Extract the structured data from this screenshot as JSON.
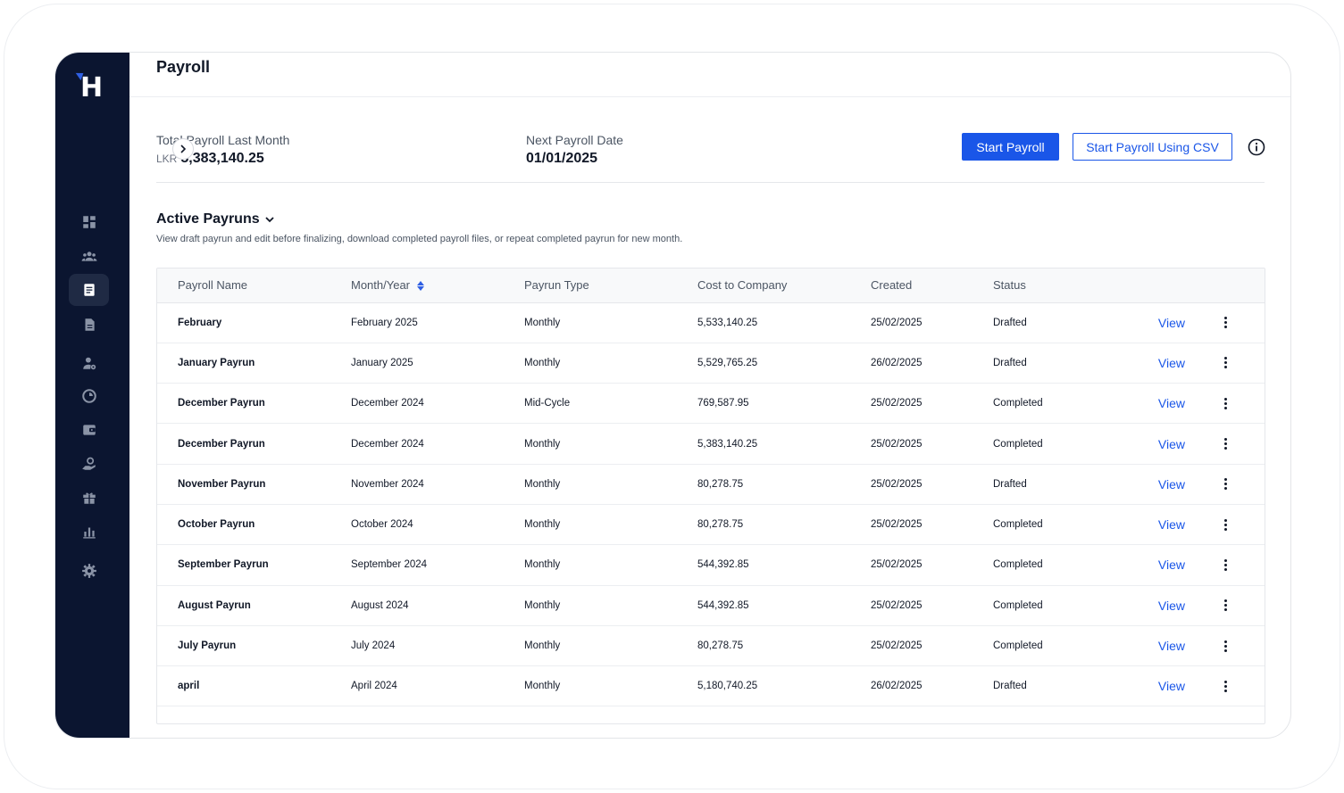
{
  "header": {
    "title": "Payroll"
  },
  "summary": {
    "total_label": "Total Payroll Last Month",
    "total_currency": "LKR",
    "total_value": "5,383,140.25",
    "next_label": "Next Payroll Date",
    "next_value": "01/01/2025"
  },
  "actions": {
    "start_payroll": "Start Payroll",
    "start_payroll_csv": "Start Payroll Using CSV"
  },
  "section": {
    "title": "Active Payruns",
    "description": "View draft payrun and edit before finalizing, download completed payroll files, or repeat completed payrun for new month."
  },
  "sidebar": {
    "logo": "H",
    "items": [
      {
        "icon": "dashboard-icon"
      },
      {
        "icon": "people-icon"
      },
      {
        "icon": "payroll-icon",
        "active": true
      },
      {
        "icon": "document-icon"
      },
      {
        "icon": "user-settings-icon"
      },
      {
        "icon": "clock-icon"
      },
      {
        "icon": "wallet-icon"
      },
      {
        "icon": "money-hand-icon"
      },
      {
        "icon": "gift-icon"
      },
      {
        "icon": "reports-icon"
      },
      {
        "icon": "gear-icon"
      }
    ]
  },
  "table": {
    "columns": [
      "Payroll Name",
      "Month/Year",
      "Payrun Type",
      "Cost to Company",
      "Created",
      "Status"
    ],
    "view_label": "View",
    "rows": [
      {
        "name": "February",
        "month": "February 2025",
        "type": "Monthly",
        "cost": "5,533,140.25",
        "created": "25/02/2025",
        "status": "Drafted"
      },
      {
        "name": "January Payrun",
        "month": "January 2025",
        "type": "Monthly",
        "cost": "5,529,765.25",
        "created": "26/02/2025",
        "status": "Drafted"
      },
      {
        "name": "December Payrun",
        "month": "December 2024",
        "type": "Mid-Cycle",
        "cost": "769,587.95",
        "created": "25/02/2025",
        "status": "Completed"
      },
      {
        "name": "December Payrun",
        "month": "December 2024",
        "type": "Monthly",
        "cost": "5,383,140.25",
        "created": "25/02/2025",
        "status": "Completed"
      },
      {
        "name": "November Payrun",
        "month": "November 2024",
        "type": "Monthly",
        "cost": "80,278.75",
        "created": "25/02/2025",
        "status": "Drafted"
      },
      {
        "name": "October Payrun",
        "month": "October 2024",
        "type": "Monthly",
        "cost": "80,278.75",
        "created": "25/02/2025",
        "status": "Completed"
      },
      {
        "name": "September Payrun",
        "month": "September 2024",
        "type": "Monthly",
        "cost": "544,392.85",
        "created": "25/02/2025",
        "status": "Completed"
      },
      {
        "name": "August Payrun",
        "month": "August 2024",
        "type": "Monthly",
        "cost": "544,392.85",
        "created": "25/02/2025",
        "status": "Completed"
      },
      {
        "name": "July Payrun",
        "month": "July 2024",
        "type": "Monthly",
        "cost": "80,278.75",
        "created": "25/02/2025",
        "status": "Completed"
      },
      {
        "name": "april",
        "month": "April 2024",
        "type": "Monthly",
        "cost": "5,180,740.25",
        "created": "26/02/2025",
        "status": "Drafted"
      }
    ]
  },
  "colors": {
    "sidebar": "#0b1530",
    "accent": "#1a56e8"
  }
}
